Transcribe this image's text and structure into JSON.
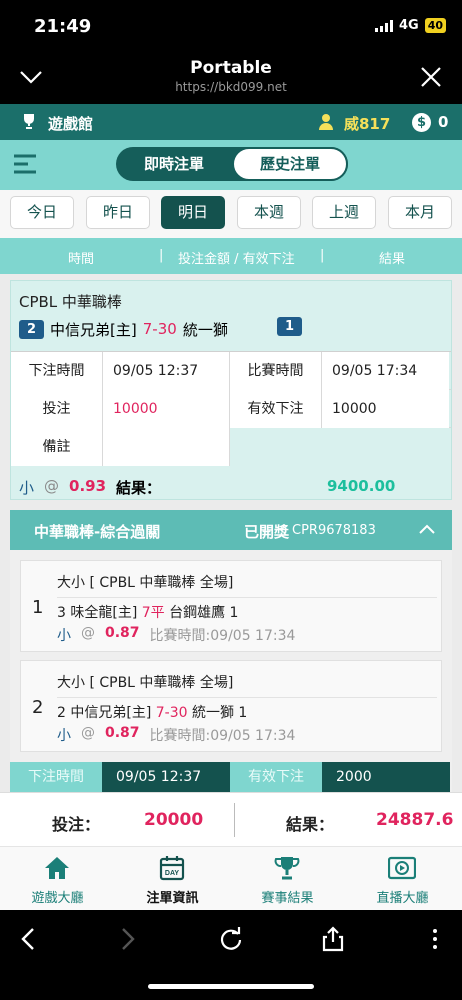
{
  "status_bar": {
    "time": "21:49",
    "network": "4G",
    "battery": "40"
  },
  "browser": {
    "title": "Portable",
    "url": "https://bkd099.net"
  },
  "topbar": {
    "hall_label": "遊戲館",
    "username": "威817",
    "balance": "0",
    "currency_symbol": "$"
  },
  "tabs": {
    "live": "即時注單",
    "history": "歷史注單",
    "active": "history"
  },
  "date_filters": {
    "items": [
      "今日",
      "昨日",
      "明日",
      "本週",
      "上週",
      "本月"
    ],
    "active": "明日"
  },
  "columns": {
    "time": "時間",
    "sep1": "|",
    "amount": "投注金額 / 有效下注",
    "sep2": "|",
    "result": "結果"
  },
  "bet1": {
    "league": "CPBL 中華職棒",
    "home_num": "2",
    "home_team": "中信兄弟[主]",
    "score": "7-30",
    "away_team": "統一獅",
    "away_num": "1",
    "rows": [
      {
        "l1": "下注時間",
        "v1": "09/05 12:37",
        "l2": "比賽時間",
        "v2": "09/05 17:34"
      },
      {
        "l1": "投注",
        "v1": "10000",
        "l2": "有效下注",
        "v2": "10000"
      },
      {
        "l1": "備註"
      }
    ],
    "pick": "小",
    "at": "@",
    "odds": "0.93",
    "result_label": "結果：",
    "payout": "9400.00"
  },
  "parlay": {
    "title": "中華職棒-綜合過關",
    "status": "已開獎",
    "code": "CPR9678183",
    "legs": [
      {
        "num": "1",
        "market": "大小 [ CPBL 中華職棒 全場]",
        "pick_prefix": "3 味全龍[主] ",
        "pick_line": "7平",
        "pick_suffix": " 台鋼雄鷹 1",
        "side": "小",
        "at": "@",
        "odds": "0.87",
        "match_time": "比賽時間:09/05 17:34"
      },
      {
        "num": "2",
        "market": "大小 [ CPBL 中華職棒 全場]",
        "pick_prefix": "2 中信兄弟[主] ",
        "pick_line": "7-30",
        "pick_suffix": " 統一獅 1",
        "side": "小",
        "at": "@",
        "odds": "0.87",
        "match_time": "比賽時間:09/05 17:34"
      }
    ],
    "footer": {
      "l1": "下注時間",
      "v1": "09/05 12:37",
      "l2": "有效下注",
      "v2": "2000"
    }
  },
  "summary": {
    "bet_label": "投注：",
    "bet_value": "20000",
    "result_label": "結果：",
    "result_value": "24887.6"
  },
  "bottom_nav": [
    {
      "label": "遊戲大廳",
      "icon": "home-icon"
    },
    {
      "label": "注單資訊",
      "icon": "calendar-icon"
    },
    {
      "label": "賽事結果",
      "icon": "trophy-icon"
    },
    {
      "label": "直播大廳",
      "icon": "play-screen-icon"
    }
  ],
  "colors": {
    "primary_dark": "#14524e",
    "teal": "#1b6f6a",
    "light_teal": "#7fd6cf",
    "accent_red": "#e0245e",
    "gold": "#f5e05a"
  }
}
